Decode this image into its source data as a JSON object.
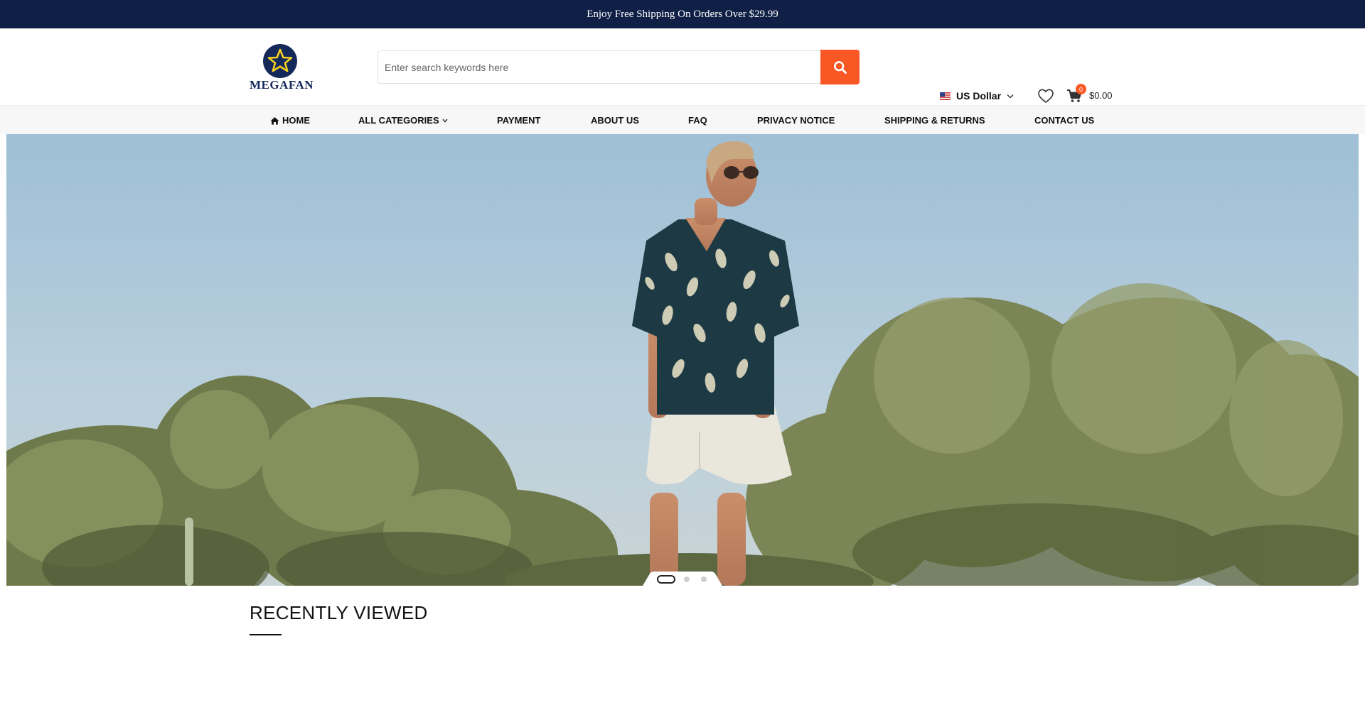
{
  "announcement": "Enjoy Free Shipping On Orders Over $29.99",
  "brand": {
    "name": "MEGAFAN",
    "navy": "#15285a",
    "star": "#f5d21f"
  },
  "search": {
    "placeholder": "Enter search keywords here",
    "button_icon": "search-icon"
  },
  "currency": {
    "label": "US Dollar",
    "flag_icon": "us-flag-icon"
  },
  "cart": {
    "count": "0",
    "total": "$0.00"
  },
  "nav": {
    "home": "HOME",
    "categories": "ALL CATEGORIES",
    "payment": "PAYMENT",
    "about": "ABOUT US",
    "faq": "FAQ",
    "privacy": "PRIVACY NOTICE",
    "shipping": "SHIPPING & RETURNS",
    "contact": "CONTACT US"
  },
  "slider": {
    "slides": 3,
    "active": 1
  },
  "recently_viewed": {
    "title": "RECENTLY VIEWED"
  },
  "colors": {
    "accent": "#f95724",
    "topbar": "#0f1f45"
  }
}
